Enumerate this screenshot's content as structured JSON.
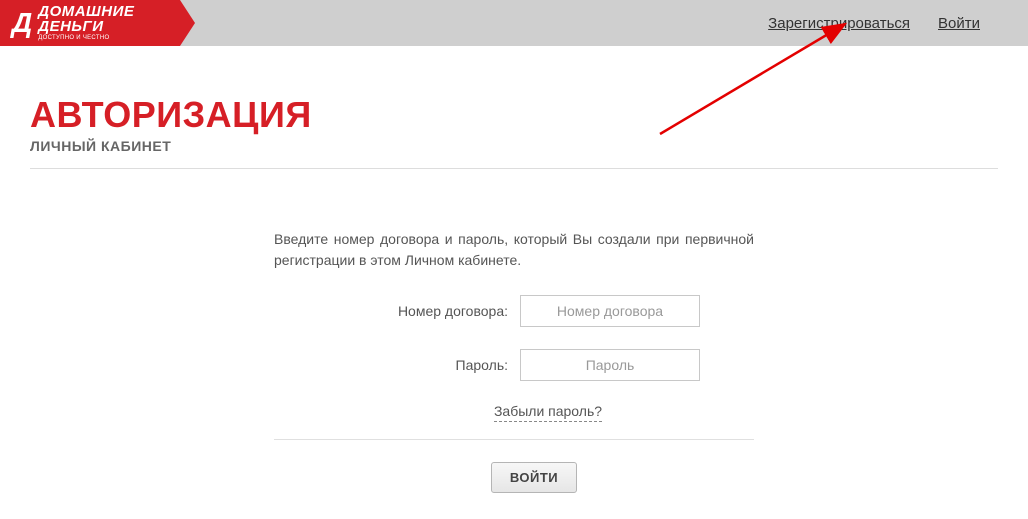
{
  "header": {
    "logo": {
      "icon_text": "Д",
      "line1": "ДОМАШНИЕ",
      "line2": "ДЕНЬГИ",
      "tagline": "ДОСТУПНО И ЧЕСТНО"
    },
    "nav": {
      "register": "Зарегистрироваться",
      "login": "Войти"
    }
  },
  "page": {
    "title": "АВТОРИЗАЦИЯ",
    "subtitle": "ЛИЧНЫЙ КАБИНЕТ"
  },
  "form": {
    "instruction": "Введите номер договора и пароль, который Вы создали при первичной регистрации в этом Личном кабинете.",
    "contract_label": "Номер договора:",
    "contract_placeholder": "Номер договора",
    "password_label": "Пароль:",
    "password_placeholder": "Пароль",
    "forgot_label": "Забыли пароль?",
    "submit_label": "ВОЙТИ"
  }
}
